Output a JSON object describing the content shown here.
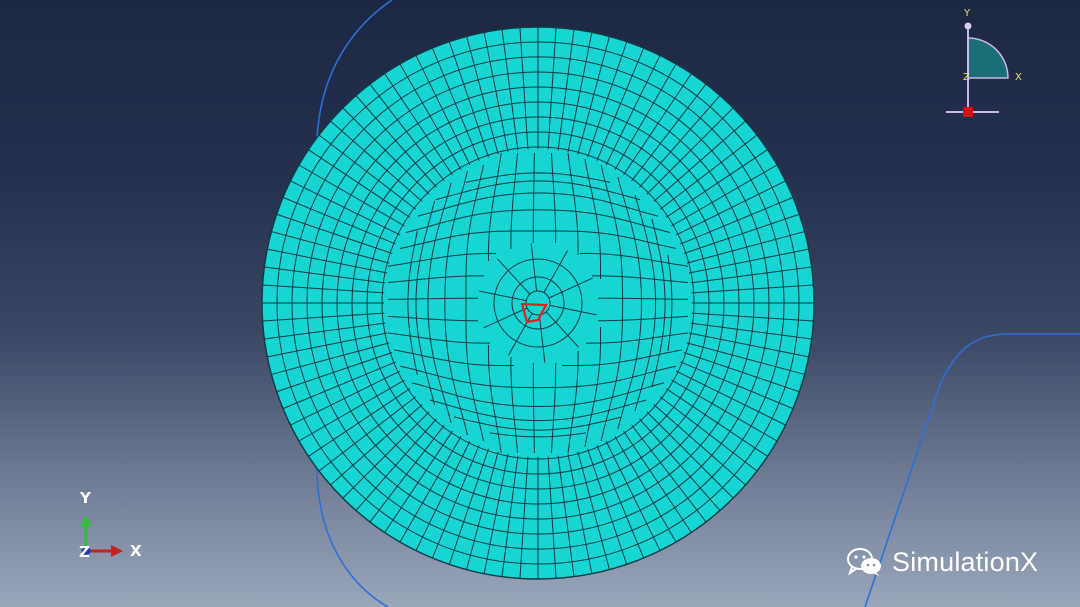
{
  "viewport": {
    "triad_bottom_left": {
      "x_label": "X",
      "y_label": "Y",
      "z_label": "Z"
    },
    "triad_top_right": {
      "x_label": "X",
      "y_label": "Y",
      "z_label": "Z"
    },
    "mesh": {
      "shape": "circular-disk",
      "element_type": "quad",
      "fill_color": "#16d5d2",
      "edge_color": "#0b3b44",
      "highlighted_element_color": "#e3201b"
    }
  },
  "watermark": {
    "icon": "wechat-icon",
    "text": "SimulationX"
  }
}
